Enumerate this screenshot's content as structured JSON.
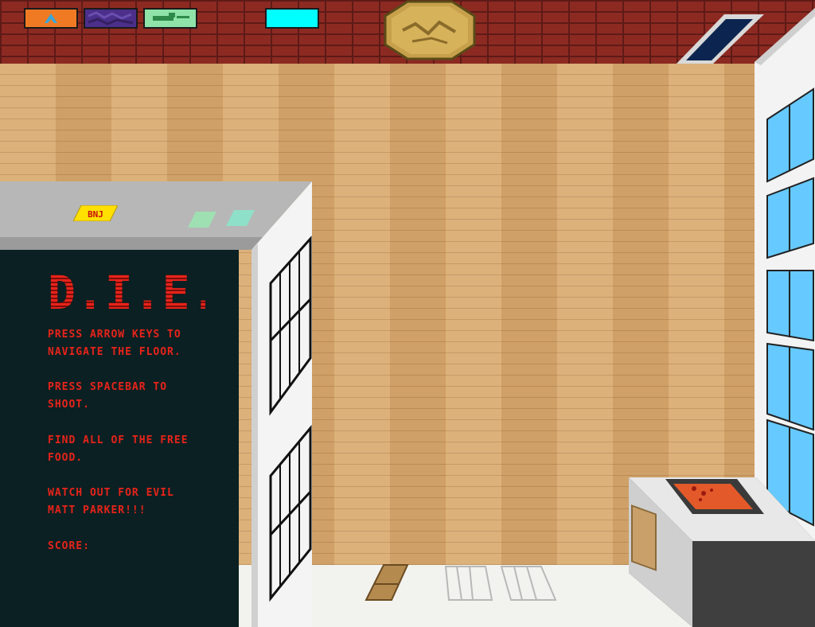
{
  "toolbar": {
    "slots": [
      {
        "name": "orange-slot",
        "color": "#f07a23"
      },
      {
        "name": "purple-slot",
        "color": "#4b2f8a"
      },
      {
        "name": "green-slot",
        "color": "#8fe3a8"
      },
      {
        "name": "cyan-slot",
        "color": "#00ffff"
      }
    ]
  },
  "sign": {
    "text": "BNJ"
  },
  "panel": {
    "title": "D.I.E.T.P.",
    "lines": [
      "PRESS ARROW KEYS TO",
      "NAVIGATE THE FLOOR.",
      "PRESS SPACEBAR TO",
      "SHOOT.",
      "FIND ALL OF THE FREE",
      "FOOD.",
      "WATCH OUT FOR EVIL",
      "MATT PARKER!!!",
      "SCORE:"
    ]
  },
  "colors": {
    "text_red": "#e8231a",
    "board_dark": "#0b2022",
    "wood": "#d7a96f",
    "brick": "#8c2a22",
    "window_blue": "#66c9ff"
  }
}
